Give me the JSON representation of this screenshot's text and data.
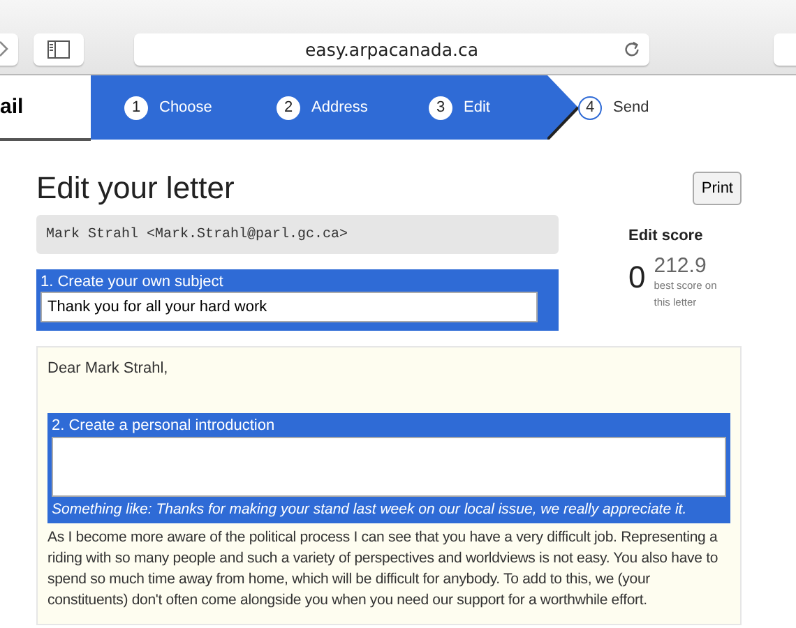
{
  "browser": {
    "url": "easy.arpacanada.ca"
  },
  "site": {
    "logo_text": "ail"
  },
  "steps": [
    {
      "number": "1",
      "label": "Choose",
      "active": true
    },
    {
      "number": "2",
      "label": "Address",
      "active": true
    },
    {
      "number": "3",
      "label": "Edit",
      "active": true
    },
    {
      "number": "4",
      "label": "Send",
      "active": false
    }
  ],
  "heading": "Edit your letter",
  "print_button": "Print",
  "recipient": "Mark Strahl <Mark.Strahl@parl.gc.ca>",
  "subject": {
    "label": "1. Create your own subject",
    "value": "Thank you for all your hard work"
  },
  "edit_score": {
    "title": "Edit score",
    "score": "0",
    "best": "212.9",
    "best_caption": "best score on this letter"
  },
  "letter": {
    "greeting": "Dear Mark Strahl,",
    "introduction": {
      "label": "2. Create a personal introduction",
      "hint": "Something like: Thanks for making your stand last week on our local issue, we really appreciate it."
    },
    "body": "As I become more aware of the political process I can see that you have a very difficult job. Representing a riding with so many people and such a variety of perspectives and worldviews is not easy. You also have to spend so much time away from home, which will be difficult for anybody. To add to this, we (your constituents) don't often come alongside you when you need our support for a worthwhile effort."
  }
}
